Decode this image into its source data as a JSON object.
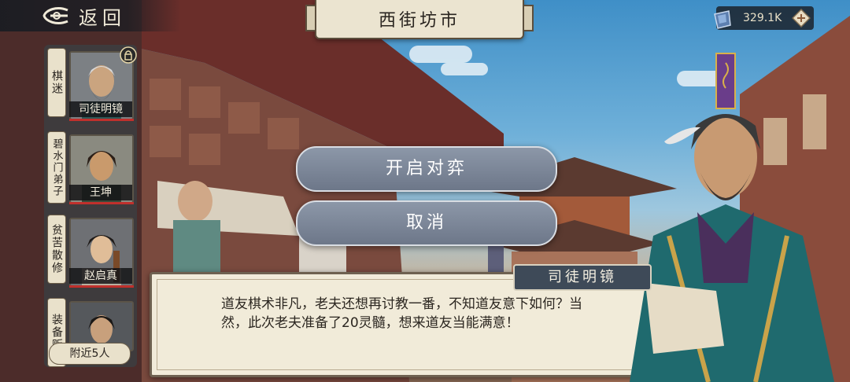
{
  "header": {
    "back_label": "返回",
    "location_title": "西街坊市"
  },
  "currency": {
    "value": "329.1K",
    "icon": "spirit-gem-icon",
    "add_icon": "plus-diamond-icon"
  },
  "side_list": {
    "entries": [
      {
        "tag": "棋迷",
        "name": "司徒明镜",
        "badge_icon": "lock-icon"
      },
      {
        "tag": "碧水门弟子",
        "name": "王坤"
      },
      {
        "tag": "贫苦散修",
        "name": "赵启真"
      },
      {
        "tag": "装备贩",
        "name": ""
      }
    ],
    "nearby_label": "附近5人"
  },
  "choices": [
    {
      "label": "开启对弈"
    },
    {
      "label": "取消"
    }
  ],
  "dialog": {
    "speaker": "司徒明镜",
    "text": "道友棋术非凡，老夫还想再讨教一番，不知道友意下如何？当然，此次老夫准备了20灵髓，想来道友当能满意！"
  },
  "colors": {
    "accent": "#6d7789",
    "panel": "#f1ebd9",
    "hp": "#c0302c"
  }
}
